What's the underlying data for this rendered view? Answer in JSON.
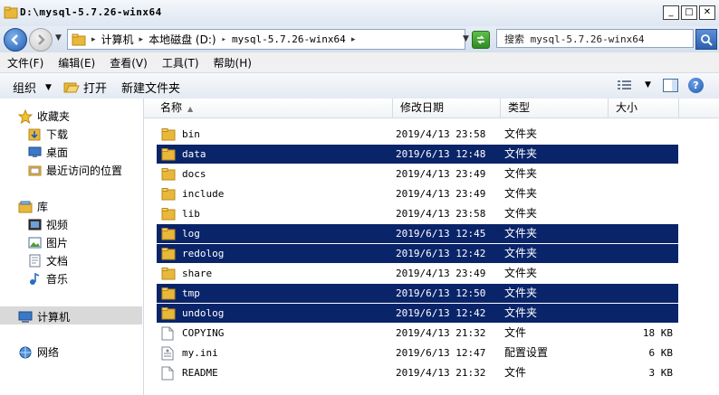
{
  "window": {
    "title": "D:\\mysql-5.7.26-winx64",
    "min_glyph": "_",
    "max_glyph": "□",
    "close_glyph": "✕"
  },
  "address": {
    "crumbs": [
      "计算机",
      "本地磁盘 (D:)",
      "mysql-5.7.26-winx64"
    ],
    "search_placeholder": "搜索 mysql-5.7.26-winx64"
  },
  "menu": [
    "文件(F)",
    "编辑(E)",
    "查看(V)",
    "工具(T)",
    "帮助(H)"
  ],
  "toolbar": {
    "organize": "组织",
    "open": "打开",
    "new_folder": "新建文件夹",
    "help": "?"
  },
  "nav": {
    "favorites": "收藏夹",
    "downloads": "下载",
    "desktop": "桌面",
    "recent": "最近访问的位置",
    "libraries": "库",
    "videos": "视频",
    "pictures": "图片",
    "documents": "文档",
    "music": "音乐",
    "computer": "计算机",
    "network": "网络"
  },
  "columns": {
    "name": "名称",
    "modified": "修改日期",
    "type": "类型",
    "size": "大小"
  },
  "files": [
    {
      "name": "bin",
      "modified": "2019/4/13 23:58",
      "type": "文件夹",
      "size": "",
      "kind": "folder",
      "selected": false
    },
    {
      "name": "data",
      "modified": "2019/6/13 12:48",
      "type": "文件夹",
      "size": "",
      "kind": "folder",
      "selected": true
    },
    {
      "name": "docs",
      "modified": "2019/4/13 23:49",
      "type": "文件夹",
      "size": "",
      "kind": "folder",
      "selected": false
    },
    {
      "name": "include",
      "modified": "2019/4/13 23:49",
      "type": "文件夹",
      "size": "",
      "kind": "folder",
      "selected": false
    },
    {
      "name": "lib",
      "modified": "2019/4/13 23:58",
      "type": "文件夹",
      "size": "",
      "kind": "folder",
      "selected": false
    },
    {
      "name": "log",
      "modified": "2019/6/13 12:45",
      "type": "文件夹",
      "size": "",
      "kind": "folder",
      "selected": true
    },
    {
      "name": "redolog",
      "modified": "2019/6/13 12:42",
      "type": "文件夹",
      "size": "",
      "kind": "folder",
      "selected": true
    },
    {
      "name": "share",
      "modified": "2019/4/13 23:49",
      "type": "文件夹",
      "size": "",
      "kind": "folder",
      "selected": false
    },
    {
      "name": "tmp",
      "modified": "2019/6/13 12:50",
      "type": "文件夹",
      "size": "",
      "kind": "folder",
      "selected": true
    },
    {
      "name": "undolog",
      "modified": "2019/6/13 12:42",
      "type": "文件夹",
      "size": "",
      "kind": "folder",
      "selected": true
    },
    {
      "name": "COPYING",
      "modified": "2019/4/13 21:32",
      "type": "文件",
      "size": "18 KB",
      "kind": "file",
      "selected": false
    },
    {
      "name": "my.ini",
      "modified": "2019/6/13 12:47",
      "type": "配置设置",
      "size": "6 KB",
      "kind": "ini",
      "selected": false
    },
    {
      "name": "README",
      "modified": "2019/4/13 21:32",
      "type": "文件",
      "size": "3 KB",
      "kind": "file",
      "selected": false
    }
  ],
  "colors": {
    "selection": "#0a246a",
    "folder": "#e9b83a"
  }
}
